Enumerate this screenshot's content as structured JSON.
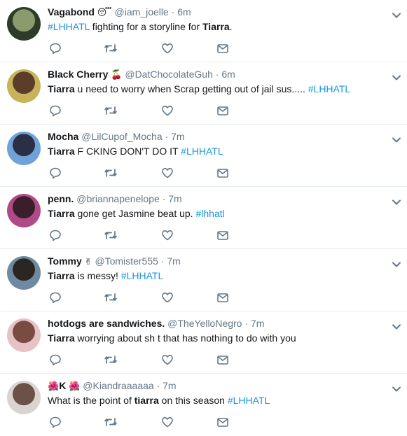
{
  "tweets": [
    {
      "name": "Vagabond",
      "name_emoji": "😴",
      "handle": "@iam_joelle",
      "time": "6m",
      "body": [
        {
          "t": "#LHHATL",
          "s": "tag"
        },
        {
          "t": " fighting for a storyline for ",
          "s": ""
        },
        {
          "t": "Tiarra",
          "s": "bold"
        },
        {
          "t": ".",
          "s": ""
        }
      ],
      "avatar_colors": [
        "#2f3a28",
        "#8a9b6e"
      ]
    },
    {
      "name": "Black Cherry",
      "name_emoji": "🍒",
      "handle": "@DatChocolateGuh",
      "time": "6m",
      "body": [
        {
          "t": "Tiarra",
          "s": "bold"
        },
        {
          "t": " u need to worry when Scrap getting out of jail sus..... ",
          "s": ""
        },
        {
          "t": "#LHHATL",
          "s": "tag"
        }
      ],
      "avatar_colors": [
        "#c9b35a",
        "#5b3d2a"
      ]
    },
    {
      "name": "Mocha",
      "name_emoji": "",
      "handle": "@LilCupof_Mocha",
      "time": "7m",
      "body": [
        {
          "t": "Tiarra",
          "s": "bold"
        },
        {
          "t": " F   CKING DON'T DO IT ",
          "s": ""
        },
        {
          "t": "#LHHATL",
          "s": "tag"
        }
      ],
      "avatar_colors": [
        "#6fa3d8",
        "#2a2f45"
      ]
    },
    {
      "name": "penn.",
      "name_emoji": "",
      "handle": "@briannapenelope",
      "time": "7m",
      "body": [
        {
          "t": "Tiarra",
          "s": "bold"
        },
        {
          "t": " gone get Jasmine beat up.  ",
          "s": ""
        },
        {
          "t": "#lhhatl",
          "s": "tag"
        }
      ],
      "avatar_colors": [
        "#b04a86",
        "#3a1f2a"
      ]
    },
    {
      "name": "Tommy",
      "name_emoji": "✌",
      "handle": "@Tomister555",
      "time": "7m",
      "body": [
        {
          "t": "Tiarra",
          "s": "bold"
        },
        {
          "t": " is messy! ",
          "s": ""
        },
        {
          "t": "#LHHATL",
          "s": "tag"
        }
      ],
      "avatar_colors": [
        "#6d8aa0",
        "#2b2622"
      ]
    },
    {
      "name": "hotdogs are sandwiches.",
      "name_emoji": "",
      "handle": "@TheYelloNegro",
      "time": "7m",
      "body": [
        {
          "t": "Tiarra",
          "s": "bold"
        },
        {
          "t": " worrying about sh  t that has nothing to do with you",
          "s": ""
        }
      ],
      "avatar_colors": [
        "#e7c2c4",
        "#7a4b43"
      ]
    },
    {
      "name": "K",
      "name_prefix_emoji": "🌺",
      "name_emoji": "🌺",
      "handle": "@Kiandraaaaaa",
      "time": "7m",
      "body": [
        {
          "t": "What is the point of ",
          "s": ""
        },
        {
          "t": "tiarra",
          "s": "bold"
        },
        {
          "t": " on this  season  ",
          "s": ""
        },
        {
          "t": "#LHHATL",
          "s": "tag"
        }
      ],
      "avatar_colors": [
        "#d9d4d2",
        "#6b5148"
      ]
    }
  ],
  "icons": [
    "reply-icon",
    "retweet-icon",
    "like-icon",
    "direct-message-icon",
    "chevron-down-icon"
  ],
  "colors": {
    "icon": "#657786",
    "hashtag": "#1b95e0",
    "divider": "#e6ecf0",
    "text": "#14171a"
  }
}
